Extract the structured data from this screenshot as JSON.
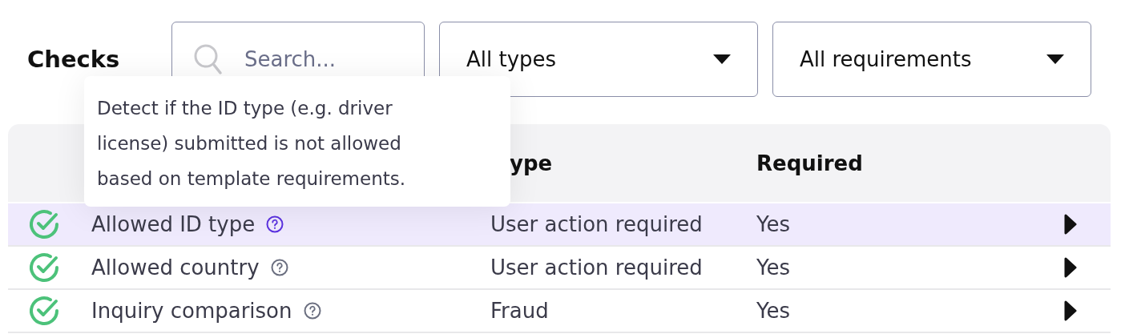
{
  "title": "Checks",
  "search": {
    "placeholder": "Search..."
  },
  "filters": [
    {
      "value": "All types"
    },
    {
      "value": "All requirements"
    }
  ],
  "tooltip": "Detect if the ID type (e.g. driver license) submitted is not allowed based on template requirements.",
  "table": {
    "columns": [
      "",
      "ype",
      "Required"
    ],
    "rows": [
      {
        "name": "Allowed ID type",
        "type": "User action required",
        "required": "Yes",
        "selected": true
      },
      {
        "name": "Allowed country",
        "type": "User action required",
        "required": "Yes",
        "selected": false
      },
      {
        "name": "Inquiry comparison",
        "type": "Fraud",
        "required": "Yes",
        "selected": false
      }
    ]
  }
}
